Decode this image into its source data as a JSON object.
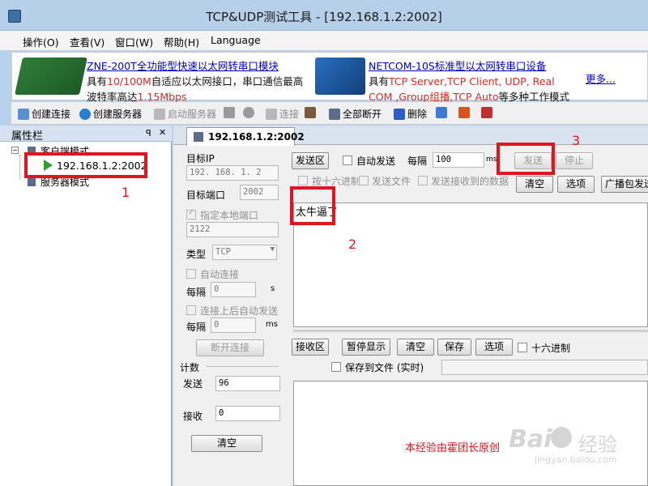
{
  "window": {
    "title": "TCP&UDP测试工具 - [192.168.1.2:2002]"
  },
  "menu": [
    "操作(O)",
    "查看(V)",
    "窗口(W)",
    "帮助(H)",
    "Language"
  ],
  "banner": {
    "ad1": {
      "title": "ZNE-200T全功能型快速以太网转串口模块",
      "line1_a": "具有",
      "line1_red": "10/100M",
      "line1_b": "自适应以太网接口，串口通信最高",
      "line2_a": "波特率高达",
      "line2_red": "1.15Mbps"
    },
    "ad2": {
      "title": "NETCOM-10S标准型以太网转串口设备",
      "line1_a": "具有",
      "line1_red": "TCP Server,TCP Client, UDP, Real",
      "line2_red1": "COM ,Group组播,TCP Auto",
      "line2_b": "等多种工作模式"
    },
    "more": "更多..."
  },
  "toolbar": {
    "create_conn": "创建连接",
    "create_server": "创建服务器",
    "start_server": "启动服务器",
    "connect": "连接",
    "disconnect_all": "全部断开",
    "delete": "删除"
  },
  "sidebar": {
    "title": "属性栏",
    "pin": "ꟼ",
    "close": "✕",
    "client_mode": "客户端模式",
    "connection": "192.168.1.2:2002",
    "server_mode": "服务器模式"
  },
  "tab": {
    "label": "192.168.1.2:2002"
  },
  "conn": {
    "target_ip_label": "目标IP",
    "target_ip": "192. 168. 1. 2",
    "target_port_label": "目标端口",
    "target_port": "2002",
    "local_port_check": "指定本地端口",
    "local_port": "2122",
    "type_label": "类型",
    "type_value": "TCP",
    "auto_connect": "自动连接",
    "interval_label": "每隔",
    "interval1": "0",
    "unit_s": "s",
    "auto_send_after": "连接上后自动发送",
    "interval2": "0",
    "unit_ms": "ms",
    "disconnect": "断开连接",
    "stats_label": "计数",
    "sent_label": "发送",
    "sent_value": "96",
    "recv_label": "接收",
    "recv_value": "0",
    "clear": "清空"
  },
  "send": {
    "area_label": "发送区",
    "auto_send": "自动发送",
    "interval_label": "每隔",
    "interval_value": "100",
    "unit": "ms",
    "send_btn": "发送",
    "stop_btn": "停止",
    "hex": "按十六进制",
    "send_file": "发送文件",
    "send_recv_data": "发送接收到的数据",
    "clear": "清空",
    "options": "选项",
    "broadcast": "广播包发送",
    "content": "太牛逼了"
  },
  "recv": {
    "area_label": "接收区",
    "pause": "暂停显示",
    "clear": "清空",
    "save": "保存",
    "options": "选项",
    "hex": "十六进制",
    "save_to_file": "保存到文件 (实时)"
  },
  "annotations": {
    "a1": "1",
    "a2": "2",
    "a3": "3",
    "caption": "本经验由霍团长原创"
  },
  "watermark": {
    "brand": "Bai",
    "cn": "经验",
    "site": "jingyan.baidu.com"
  }
}
